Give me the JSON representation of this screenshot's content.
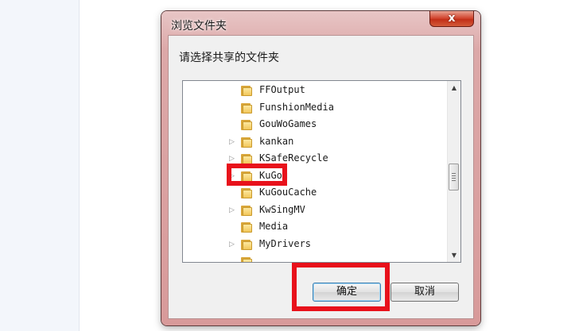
{
  "dialog": {
    "title": "浏览文件夹",
    "close_glyph": "x",
    "prompt": "请选择共享的文件夹"
  },
  "tree": {
    "items": [
      {
        "label": "FFOutput",
        "has_children": false
      },
      {
        "label": "FunshionMedia",
        "has_children": false
      },
      {
        "label": "GouWoGames",
        "has_children": false
      },
      {
        "label": "kankan",
        "has_children": true
      },
      {
        "label": "KSafeRecycle",
        "has_children": true
      },
      {
        "label": "KuGou",
        "has_children": true
      },
      {
        "label": "KuGouCache",
        "has_children": false
      },
      {
        "label": "KwSingMV",
        "has_children": true
      },
      {
        "label": "Media",
        "has_children": false
      },
      {
        "label": "MyDrivers",
        "has_children": true
      }
    ],
    "scroll_up_glyph": "▲",
    "scroll_down_glyph": "▼"
  },
  "buttons": {
    "ok_label": "确定",
    "cancel_label": "取消"
  },
  "icons": {
    "folder": "folder-icon",
    "expander": "expand-arrow-icon",
    "close": "close-icon"
  },
  "colors": {
    "annotation": "#e8111b",
    "folder": "#f2c75a",
    "frame": "#dca8a8",
    "close_button": "#c12f18"
  }
}
